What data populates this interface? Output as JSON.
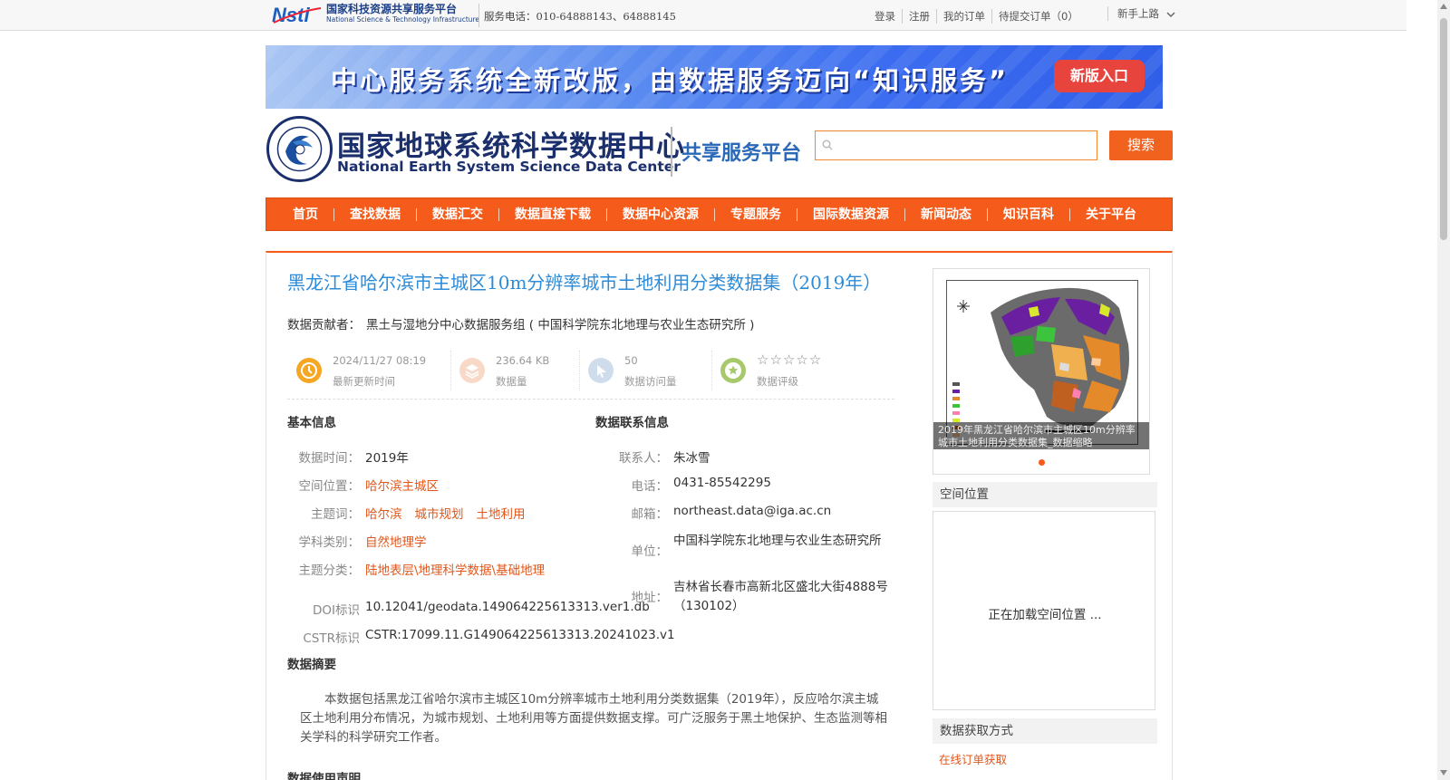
{
  "topbar": {
    "platform_cn": "国家科技资源共享服务平台",
    "platform_en": "National Science & Technology Infrastructure",
    "hotline": "服务电话：010-64888143、64888145",
    "links": [
      "登录",
      "注册",
      "我的订单",
      "待提交订单（0）"
    ],
    "newbie": "新手上路"
  },
  "banner": {
    "text": "中心服务系统全新改版，由数据服务迈向“知识服务”",
    "button": "新版入口"
  },
  "header": {
    "title_cn": "国家地球系统科学数据中心",
    "title_en": "National Earth System Science Data Center",
    "subtitle": "共享服务平台",
    "search_placeholder": "",
    "search_button": "搜索"
  },
  "nav": {
    "items": [
      "首页",
      "查找数据",
      "数据汇交",
      "数据直接下载",
      "数据中心资源",
      "专题服务",
      "国际数据资源",
      "新闻动态",
      "知识百科",
      "关于平台"
    ]
  },
  "dataset": {
    "title": "黑龙江省哈尔滨市主城区10m分辨率城市土地利用分类数据集（2019年）",
    "contributor_label": "数据贡献者：",
    "contributor": "黑土与湿地分中心数据服务组 ( 中国科学院东北地理与农业生态研究所 )",
    "stats": {
      "updated": "2024/11/27 08:19",
      "updated_label": "最新更新时间",
      "size": "236.64 KB",
      "size_label": "数据量",
      "visits": "50",
      "visits_label": "数据访问量",
      "stars": "☆☆☆☆☆",
      "rating_label": "数据评级"
    }
  },
  "basic_info": {
    "heading": "基本信息",
    "time_label": "数据时间：",
    "time": "2019年",
    "location_label": "空间位置：",
    "location": "哈尔滨主城区",
    "keywords_label": "主题词：",
    "keywords": [
      "哈尔滨",
      "城市规划",
      "土地利用"
    ],
    "discipline_label": "学科类别：",
    "discipline": "自然地理学",
    "category_label": "主题分类：",
    "category": "陆地表层\\地理科学数据\\基础地理",
    "doi_label": "DOI标识",
    "doi": "10.12041/geodata.149064225613313.ver1.db",
    "cstr_label": "CSTR标识",
    "cstr": "CSTR:17099.11.G149064225613313.20241023.v1"
  },
  "contact_info": {
    "heading": "数据联系信息",
    "contact_label": "联系人：",
    "contact": "朱冰雪",
    "phone_label": "电话：",
    "phone": "0431-85542295",
    "email_label": "邮箱：",
    "email": "northeast.data@iga.ac.cn",
    "org_label": "单位：",
    "org": "中国科学院东北地理与农业生态研究所",
    "addr_label": "地址：",
    "addr": "吉林省长春市高新北区盛北大街4888号（130102）"
  },
  "abstract": {
    "heading": "数据摘要",
    "text": "本数据包括黑龙江省哈尔滨市主城区10m分辨率城市土地利用分类数据集（2019年），反应哈尔滨主城区土地利用分布情况，为城市规划、土地利用等方面提供数据支撑。可广泛服务于黑土地保护、生态监测等相关学科的科学研究工作者。"
  },
  "usage": {
    "heading": "数据使用声明"
  },
  "sidebar": {
    "thumb_caption": "2019年黑龙江省哈尔滨市主城区10m分辨率城市土地利用分类数据集_数据缩略",
    "space_heading": "空间位置",
    "space_loading": "正在加载空间位置 ...",
    "access_heading": "数据获取方式",
    "access_link": "在线订单获取"
  },
  "colors": {
    "nav_orange": "#f55b1a",
    "title_blue": "#2d8bd8",
    "link_orange": "#e0561b"
  }
}
